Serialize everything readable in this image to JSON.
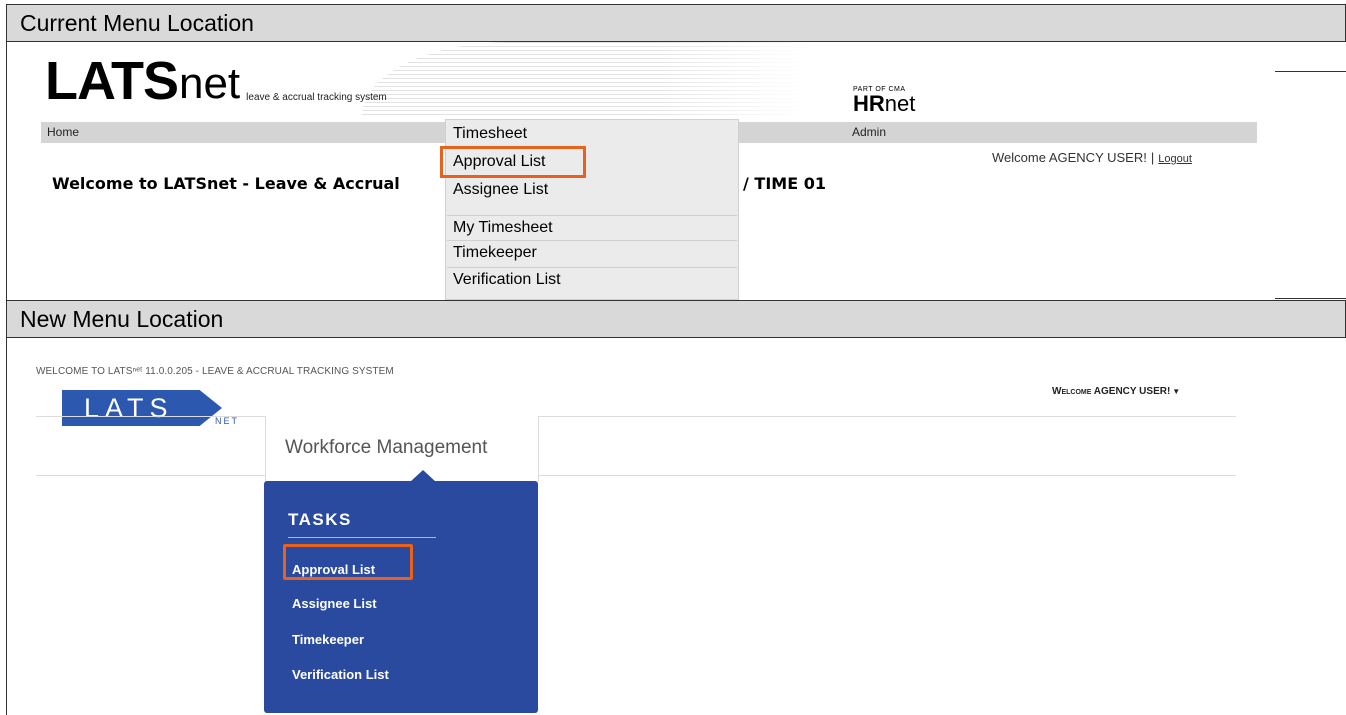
{
  "sections": {
    "current_label": "Current Menu Location",
    "new_label": "New Menu Location"
  },
  "old_ui": {
    "logo_lats": "LATS",
    "logo_net": "net",
    "tagline": "leave & accrual tracking system",
    "hrnet_part": "PART OF CMA",
    "hrnet_hr": "HR",
    "hrnet_net": "net",
    "nav": {
      "home": "Home",
      "admin": "Admin"
    },
    "welcome_heading": "Welcome to LATSnet - Leave & Accrual",
    "welcome_suffix": "TIME 01",
    "user_greeting": "Welcome AGENCY USER!",
    "separator": "|",
    "logout": "Logout",
    "menu": {
      "title": "Timesheet",
      "items": [
        "Approval List",
        "Assignee List",
        "My Timesheet",
        "Timekeeper",
        "Verification List"
      ],
      "highlighted": "Approval List"
    }
  },
  "new_ui": {
    "top_line": "WELCOME TO LATSⁿᵉᵗ 11.0.0.205 - LEAVE & ACCRUAL TRACKING SYSTEM",
    "user_greeting": "Welcome AGENCY USER!",
    "logo_text": "LATS",
    "logo_sub": "NET",
    "tab_label": "Workforce Management",
    "tasks": {
      "title": "TASKS",
      "items": [
        "Approval List",
        "Assignee List",
        "Timekeeper",
        "Verification List"
      ],
      "highlighted": "Approval List"
    }
  },
  "colors": {
    "highlight": "#e8621d",
    "brand_blue": "#2a4a9f",
    "header_gray": "#d9d9d9"
  }
}
